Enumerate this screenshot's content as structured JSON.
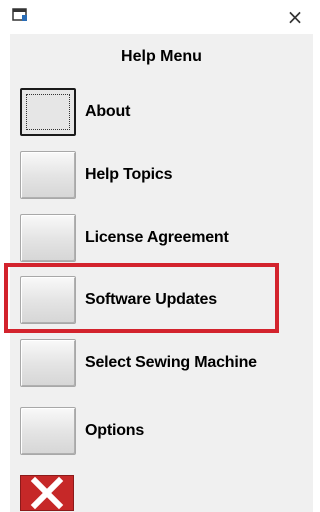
{
  "menu": {
    "title": "Help Menu",
    "items": [
      {
        "label": "About",
        "focused": true
      },
      {
        "label": "Help Topics",
        "focused": false
      },
      {
        "label": "License Agreement",
        "focused": false
      },
      {
        "label": "Software Updates",
        "focused": false,
        "highlighted": true
      },
      {
        "label": "Select Sewing Machine",
        "focused": false
      },
      {
        "label": "Options",
        "focused": false
      }
    ]
  },
  "icons": {
    "app": "window-icon",
    "close": "close-icon",
    "exit": "red-x-icon"
  },
  "colors": {
    "highlight": "#d3232d",
    "exit_button": "#c62828",
    "panel": "#f0f0f0"
  },
  "glyphs": {
    "close": "×"
  }
}
